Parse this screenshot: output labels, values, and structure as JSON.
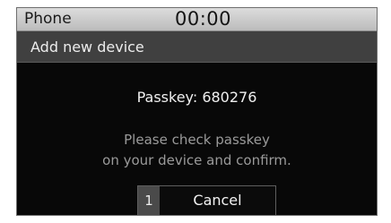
{
  "status_bar": {
    "app_title": "Phone",
    "clock": "00:00"
  },
  "subheader": {
    "title": "Add new device"
  },
  "dialog": {
    "passkey_text": "Passkey: 680276",
    "message_line1": "Please check passkey",
    "message_line2": "on your device and confirm.",
    "button_number": "1",
    "cancel_label": "Cancel"
  },
  "colors": {
    "status_bar_bg": "#c8c8c8",
    "subheader_bg": "#404040",
    "screen_bg": "#080808",
    "message_text": "#9a9a9a"
  }
}
